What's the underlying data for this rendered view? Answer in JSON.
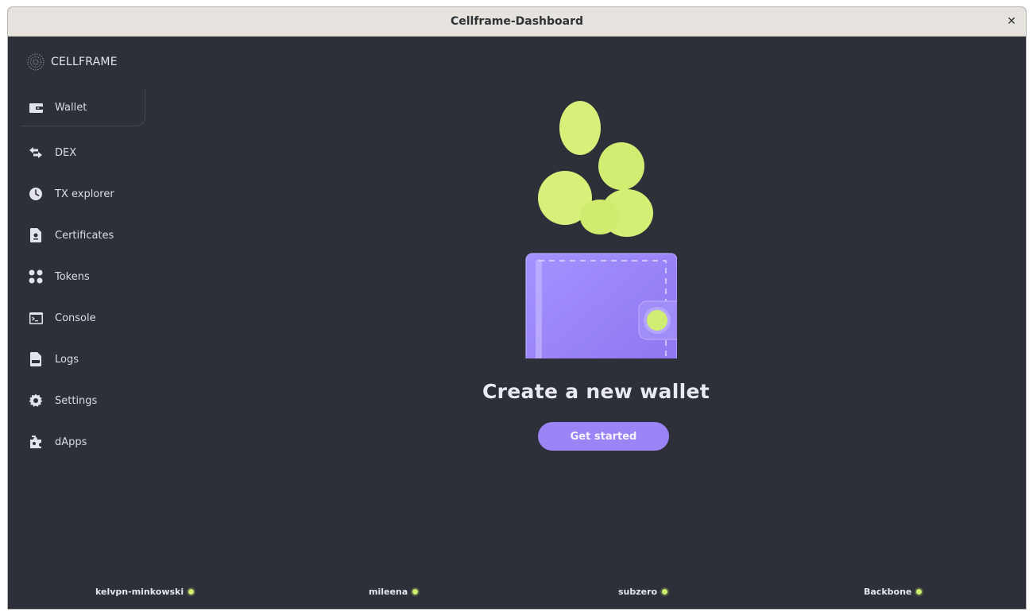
{
  "window": {
    "title": "Cellframe-Dashboard",
    "close_glyph": "✕"
  },
  "brand": {
    "name": "CELLFRAME",
    "icon": "cellframe-logo-icon"
  },
  "sidebar": {
    "items": [
      {
        "label": "Wallet",
        "icon": "wallet-icon",
        "active": true
      },
      {
        "label": "DEX",
        "icon": "swap-arrows-icon"
      },
      {
        "label": "TX explorer",
        "icon": "clock-icon"
      },
      {
        "label": "Certificates",
        "icon": "certificate-icon"
      },
      {
        "label": "Tokens",
        "icon": "tokens-dots-icon"
      },
      {
        "label": "Console",
        "icon": "terminal-icon"
      },
      {
        "label": "Logs",
        "icon": "log-file-icon"
      },
      {
        "label": "Settings",
        "icon": "gear-icon"
      },
      {
        "label": "dApps",
        "icon": "puzzle-icon"
      }
    ]
  },
  "main": {
    "heading": "Create a new wallet",
    "cta_label": "Get started"
  },
  "footer": {
    "nodes": [
      {
        "name": "kelvpn-minkowski",
        "status": "online"
      },
      {
        "name": "mileena",
        "status": "online"
      },
      {
        "name": "subzero",
        "status": "online"
      },
      {
        "name": "Backbone",
        "status": "online"
      }
    ]
  },
  "colors": {
    "background": "#2d2f39",
    "accent": "#9b84f5",
    "status_online": "#cdee6d",
    "coin": "#d6f07a"
  }
}
